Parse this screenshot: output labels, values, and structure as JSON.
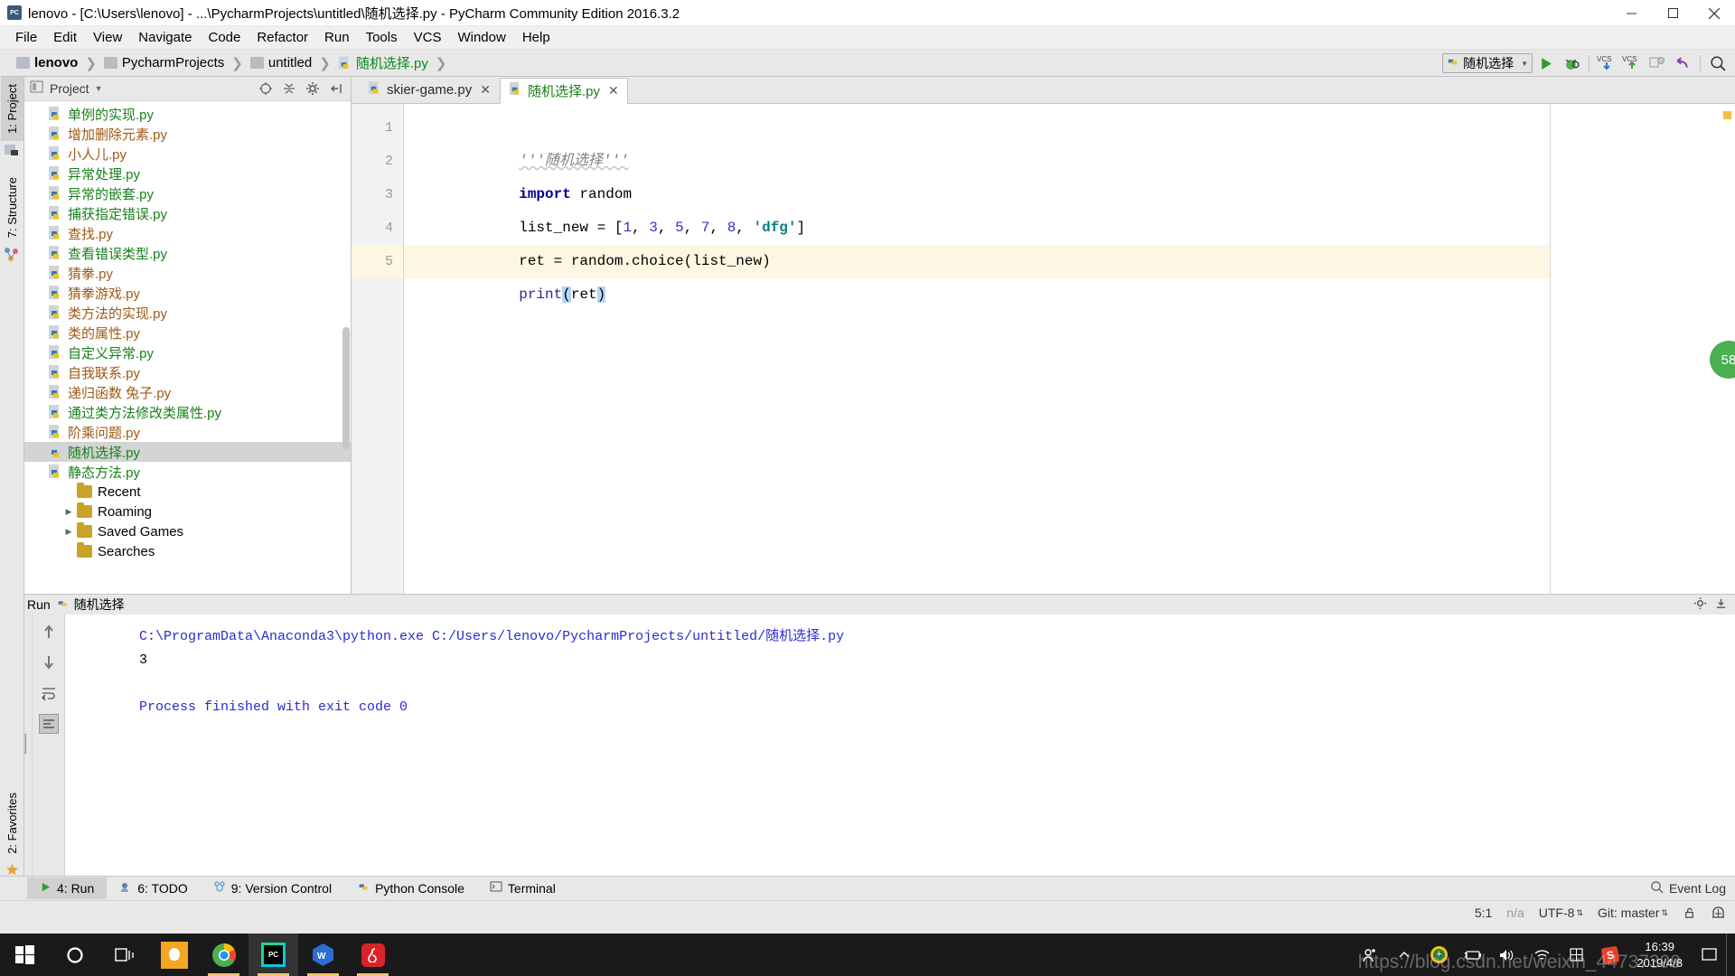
{
  "window": {
    "title": "lenovo - [C:\\Users\\lenovo] - ...\\PycharmProjects\\untitled\\随机选择.py - PyCharm Community Edition 2016.3.2",
    "minimize_label": "Minimize",
    "maximize_label": "Restore",
    "close_label": "Close"
  },
  "menubar": [
    {
      "label": "File",
      "accel": "F"
    },
    {
      "label": "Edit",
      "accel": "E"
    },
    {
      "label": "View",
      "accel": "V"
    },
    {
      "label": "Navigate",
      "accel": "N"
    },
    {
      "label": "Code",
      "accel": "C"
    },
    {
      "label": "Refactor",
      "accel": "R"
    },
    {
      "label": "Run",
      "accel": "u"
    },
    {
      "label": "Tools",
      "accel": "T"
    },
    {
      "label": "VCS",
      "accel": "S"
    },
    {
      "label": "Window",
      "accel": "W"
    },
    {
      "label": "Help",
      "accel": "H"
    }
  ],
  "breadcrumb": [
    {
      "label": "lenovo",
      "icon": "folder-icon",
      "style": "bold"
    },
    {
      "label": "PycharmProjects",
      "icon": "folder-icon",
      "style": "normal"
    },
    {
      "label": "untitled",
      "icon": "folder-icon",
      "style": "normal"
    },
    {
      "label": "随机选择.py",
      "icon": "python-file-icon",
      "style": "green"
    }
  ],
  "toolbar": {
    "run_configuration": "随机选择",
    "buttons": [
      "run-button",
      "debug-button",
      "vcs-update-button",
      "vcs-commit-button",
      "vcs-compare-button",
      "undo-button",
      "search-everywhere-button"
    ]
  },
  "project_panel": {
    "title": "Project",
    "header_icons": [
      "target-icon",
      "collapse-all-icon",
      "settings-gear-icon",
      "hide-panel-icon"
    ],
    "files": [
      {
        "label": "单例的实现.py",
        "color": "green"
      },
      {
        "label": "增加删除元素.py",
        "color": "brown"
      },
      {
        "label": "小人儿.py",
        "color": "brown"
      },
      {
        "label": "异常处理.py",
        "color": "green"
      },
      {
        "label": "异常的嵌套.py",
        "color": "green"
      },
      {
        "label": "捕获指定错误.py",
        "color": "green"
      },
      {
        "label": "查找.py",
        "color": "brown"
      },
      {
        "label": "查看错误类型.py",
        "color": "green"
      },
      {
        "label": "猜拳.py",
        "color": "brown"
      },
      {
        "label": "猜拳游戏.py",
        "color": "brown"
      },
      {
        "label": "类方法的实现.py",
        "color": "brown"
      },
      {
        "label": "类的属性.py",
        "color": "brown"
      },
      {
        "label": "自定义异常.py",
        "color": "green"
      },
      {
        "label": "自我联系.py",
        "color": "brown"
      },
      {
        "label": "递归函数 兔子.py",
        "color": "brown"
      },
      {
        "label": "通过类方法修改类属性.py",
        "color": "green"
      },
      {
        "label": "阶乘问题.py",
        "color": "brown"
      },
      {
        "label": "随机选择.py",
        "color": "green",
        "selected": true
      },
      {
        "label": "静态方法.py",
        "color": "green"
      }
    ],
    "folders": [
      {
        "label": "Recent",
        "expandable": false
      },
      {
        "label": "Roaming",
        "expandable": true
      },
      {
        "label": "Saved Games",
        "expandable": true
      },
      {
        "label": "Searches",
        "expandable": false
      }
    ]
  },
  "vertical_tabs": [
    {
      "label": "1: Project",
      "active": true
    },
    {
      "label": "7: Structure",
      "active": false
    }
  ],
  "favorites_tab": "2: Favorites",
  "editor": {
    "tabs": [
      {
        "label": "skier-game.py",
        "active": false,
        "color": "dark"
      },
      {
        "label": "随机选择.py",
        "active": true,
        "color": "green"
      }
    ],
    "lines": [
      {
        "num": "1",
        "current": false
      },
      {
        "num": "2",
        "current": false
      },
      {
        "num": "3",
        "current": false
      },
      {
        "num": "4",
        "current": false
      },
      {
        "num": "5",
        "current": true
      }
    ],
    "code": {
      "line1_doc": "'''随机选择'''",
      "line2_kw": "import",
      "line2_rest": " random",
      "line3_pre": "list_new = [",
      "line3_n1": "1",
      "line3_n2": "3",
      "line3_n3": "5",
      "line3_n4": "7",
      "line3_n5": "8",
      "line3_str": "'dfg'",
      "line3_post": "]",
      "line4": "ret = random.choice(list_new)",
      "line5_fn": "print",
      "line5_open": "(",
      "line5_arg": "ret",
      "line5_close": ")"
    },
    "float_badge": "58"
  },
  "run_panel": {
    "title": "Run",
    "config_name": "随机选择",
    "left_tool_icons": [
      "run-icon",
      "stop-icon",
      "pause-icon",
      "print-icon",
      "pin-icon",
      "trash-icon"
    ],
    "nav_tool_icons": [
      "scroll-up-icon",
      "scroll-down-icon",
      "soft-wrap-icon",
      "scroll-end-icon"
    ],
    "output": [
      {
        "text": "C:\\ProgramData\\Anaconda3\\python.exe C:/Users/lenovo/PycharmProjects/untitled/随机选择.py",
        "color": "blue"
      },
      {
        "text": "3",
        "color": "black"
      },
      {
        "text": "",
        "color": "black"
      },
      {
        "text": "Process finished with exit code 0",
        "color": "blue"
      }
    ],
    "settings_icon": "gear-icon",
    "hide_icon": "hide-icon"
  },
  "toolwindow_bar": [
    {
      "label": "4: Run",
      "icon": "run-icon",
      "active": true
    },
    {
      "label": "6: TODO",
      "icon": "todo-icon",
      "active": false
    },
    {
      "label": "9: Version Control",
      "icon": "vcs-icon",
      "active": false
    },
    {
      "label": "Python Console",
      "icon": "python-icon",
      "active": false
    },
    {
      "label": "Terminal",
      "icon": "terminal-icon",
      "active": false
    }
  ],
  "event_log": "Event Log",
  "statusbar": {
    "caret_position": "5:1",
    "line_separator": "n/a",
    "encoding": "UTF-8",
    "branch": "Git: master",
    "lock_icon": "lock-icon",
    "hector_icon": "hector-icon"
  },
  "taskbar": {
    "items": [
      {
        "name": "start-button",
        "icon": "windows-logo"
      },
      {
        "name": "cortana-button",
        "icon": "circle-icon"
      },
      {
        "name": "task-view-button",
        "icon": "task-view-icon"
      },
      {
        "name": "qq-app",
        "icon": "qq-icon",
        "open": false
      },
      {
        "name": "chrome-app",
        "icon": "chrome-icon",
        "open": true
      },
      {
        "name": "pycharm-app",
        "icon": "pycharm-icon",
        "open": true,
        "active": true
      },
      {
        "name": "wps-app",
        "icon": "wps-icon",
        "open": true
      },
      {
        "name": "netease-music-app",
        "icon": "netease-icon",
        "open": true
      }
    ],
    "tray": [
      "people-icon",
      "show-hidden-icons-chevron",
      "antivirus-icon",
      "battery-icon",
      "volume-icon",
      "wifi-icon",
      "ime-icon",
      "sogou-icon"
    ],
    "clock_time": "16:39",
    "clock_date": "2019/4/8",
    "watermark": "https://blog.csdn.net/weixin_44737399"
  }
}
